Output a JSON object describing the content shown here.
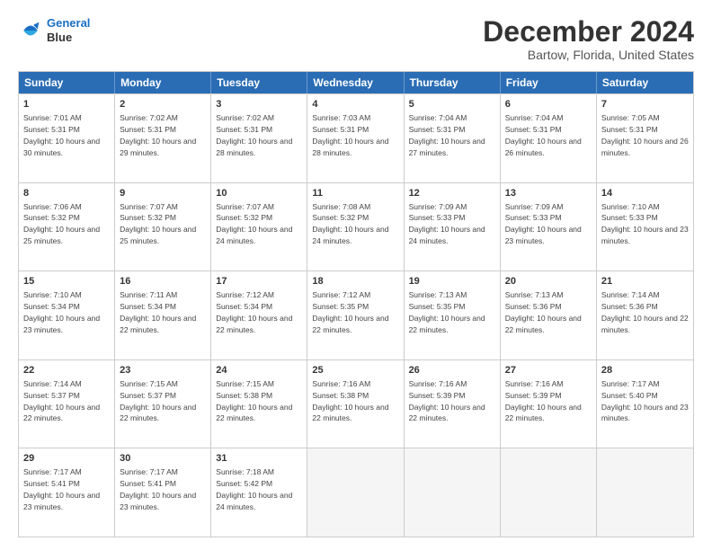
{
  "header": {
    "logo_line1": "General",
    "logo_line2": "Blue",
    "main_title": "December 2024",
    "subtitle": "Bartow, Florida, United States"
  },
  "calendar": {
    "days_of_week": [
      "Sunday",
      "Monday",
      "Tuesday",
      "Wednesday",
      "Thursday",
      "Friday",
      "Saturday"
    ],
    "rows": [
      [
        {
          "day": "1",
          "sunrise": "Sunrise: 7:01 AM",
          "sunset": "Sunset: 5:31 PM",
          "daylight": "Daylight: 10 hours and 30 minutes."
        },
        {
          "day": "2",
          "sunrise": "Sunrise: 7:02 AM",
          "sunset": "Sunset: 5:31 PM",
          "daylight": "Daylight: 10 hours and 29 minutes."
        },
        {
          "day": "3",
          "sunrise": "Sunrise: 7:02 AM",
          "sunset": "Sunset: 5:31 PM",
          "daylight": "Daylight: 10 hours and 28 minutes."
        },
        {
          "day": "4",
          "sunrise": "Sunrise: 7:03 AM",
          "sunset": "Sunset: 5:31 PM",
          "daylight": "Daylight: 10 hours and 28 minutes."
        },
        {
          "day": "5",
          "sunrise": "Sunrise: 7:04 AM",
          "sunset": "Sunset: 5:31 PM",
          "daylight": "Daylight: 10 hours and 27 minutes."
        },
        {
          "day": "6",
          "sunrise": "Sunrise: 7:04 AM",
          "sunset": "Sunset: 5:31 PM",
          "daylight": "Daylight: 10 hours and 26 minutes."
        },
        {
          "day": "7",
          "sunrise": "Sunrise: 7:05 AM",
          "sunset": "Sunset: 5:31 PM",
          "daylight": "Daylight: 10 hours and 26 minutes."
        }
      ],
      [
        {
          "day": "8",
          "sunrise": "Sunrise: 7:06 AM",
          "sunset": "Sunset: 5:32 PM",
          "daylight": "Daylight: 10 hours and 25 minutes."
        },
        {
          "day": "9",
          "sunrise": "Sunrise: 7:07 AM",
          "sunset": "Sunset: 5:32 PM",
          "daylight": "Daylight: 10 hours and 25 minutes."
        },
        {
          "day": "10",
          "sunrise": "Sunrise: 7:07 AM",
          "sunset": "Sunset: 5:32 PM",
          "daylight": "Daylight: 10 hours and 24 minutes."
        },
        {
          "day": "11",
          "sunrise": "Sunrise: 7:08 AM",
          "sunset": "Sunset: 5:32 PM",
          "daylight": "Daylight: 10 hours and 24 minutes."
        },
        {
          "day": "12",
          "sunrise": "Sunrise: 7:09 AM",
          "sunset": "Sunset: 5:33 PM",
          "daylight": "Daylight: 10 hours and 24 minutes."
        },
        {
          "day": "13",
          "sunrise": "Sunrise: 7:09 AM",
          "sunset": "Sunset: 5:33 PM",
          "daylight": "Daylight: 10 hours and 23 minutes."
        },
        {
          "day": "14",
          "sunrise": "Sunrise: 7:10 AM",
          "sunset": "Sunset: 5:33 PM",
          "daylight": "Daylight: 10 hours and 23 minutes."
        }
      ],
      [
        {
          "day": "15",
          "sunrise": "Sunrise: 7:10 AM",
          "sunset": "Sunset: 5:34 PM",
          "daylight": "Daylight: 10 hours and 23 minutes."
        },
        {
          "day": "16",
          "sunrise": "Sunrise: 7:11 AM",
          "sunset": "Sunset: 5:34 PM",
          "daylight": "Daylight: 10 hours and 22 minutes."
        },
        {
          "day": "17",
          "sunrise": "Sunrise: 7:12 AM",
          "sunset": "Sunset: 5:34 PM",
          "daylight": "Daylight: 10 hours and 22 minutes."
        },
        {
          "day": "18",
          "sunrise": "Sunrise: 7:12 AM",
          "sunset": "Sunset: 5:35 PM",
          "daylight": "Daylight: 10 hours and 22 minutes."
        },
        {
          "day": "19",
          "sunrise": "Sunrise: 7:13 AM",
          "sunset": "Sunset: 5:35 PM",
          "daylight": "Daylight: 10 hours and 22 minutes."
        },
        {
          "day": "20",
          "sunrise": "Sunrise: 7:13 AM",
          "sunset": "Sunset: 5:36 PM",
          "daylight": "Daylight: 10 hours and 22 minutes."
        },
        {
          "day": "21",
          "sunrise": "Sunrise: 7:14 AM",
          "sunset": "Sunset: 5:36 PM",
          "daylight": "Daylight: 10 hours and 22 minutes."
        }
      ],
      [
        {
          "day": "22",
          "sunrise": "Sunrise: 7:14 AM",
          "sunset": "Sunset: 5:37 PM",
          "daylight": "Daylight: 10 hours and 22 minutes."
        },
        {
          "day": "23",
          "sunrise": "Sunrise: 7:15 AM",
          "sunset": "Sunset: 5:37 PM",
          "daylight": "Daylight: 10 hours and 22 minutes."
        },
        {
          "day": "24",
          "sunrise": "Sunrise: 7:15 AM",
          "sunset": "Sunset: 5:38 PM",
          "daylight": "Daylight: 10 hours and 22 minutes."
        },
        {
          "day": "25",
          "sunrise": "Sunrise: 7:16 AM",
          "sunset": "Sunset: 5:38 PM",
          "daylight": "Daylight: 10 hours and 22 minutes."
        },
        {
          "day": "26",
          "sunrise": "Sunrise: 7:16 AM",
          "sunset": "Sunset: 5:39 PM",
          "daylight": "Daylight: 10 hours and 22 minutes."
        },
        {
          "day": "27",
          "sunrise": "Sunrise: 7:16 AM",
          "sunset": "Sunset: 5:39 PM",
          "daylight": "Daylight: 10 hours and 22 minutes."
        },
        {
          "day": "28",
          "sunrise": "Sunrise: 7:17 AM",
          "sunset": "Sunset: 5:40 PM",
          "daylight": "Daylight: 10 hours and 23 minutes."
        }
      ],
      [
        {
          "day": "29",
          "sunrise": "Sunrise: 7:17 AM",
          "sunset": "Sunset: 5:41 PM",
          "daylight": "Daylight: 10 hours and 23 minutes."
        },
        {
          "day": "30",
          "sunrise": "Sunrise: 7:17 AM",
          "sunset": "Sunset: 5:41 PM",
          "daylight": "Daylight: 10 hours and 23 minutes."
        },
        {
          "day": "31",
          "sunrise": "Sunrise: 7:18 AM",
          "sunset": "Sunset: 5:42 PM",
          "daylight": "Daylight: 10 hours and 24 minutes."
        },
        {
          "day": "",
          "sunrise": "",
          "sunset": "",
          "daylight": ""
        },
        {
          "day": "",
          "sunrise": "",
          "sunset": "",
          "daylight": ""
        },
        {
          "day": "",
          "sunrise": "",
          "sunset": "",
          "daylight": ""
        },
        {
          "day": "",
          "sunrise": "",
          "sunset": "",
          "daylight": ""
        }
      ]
    ]
  }
}
